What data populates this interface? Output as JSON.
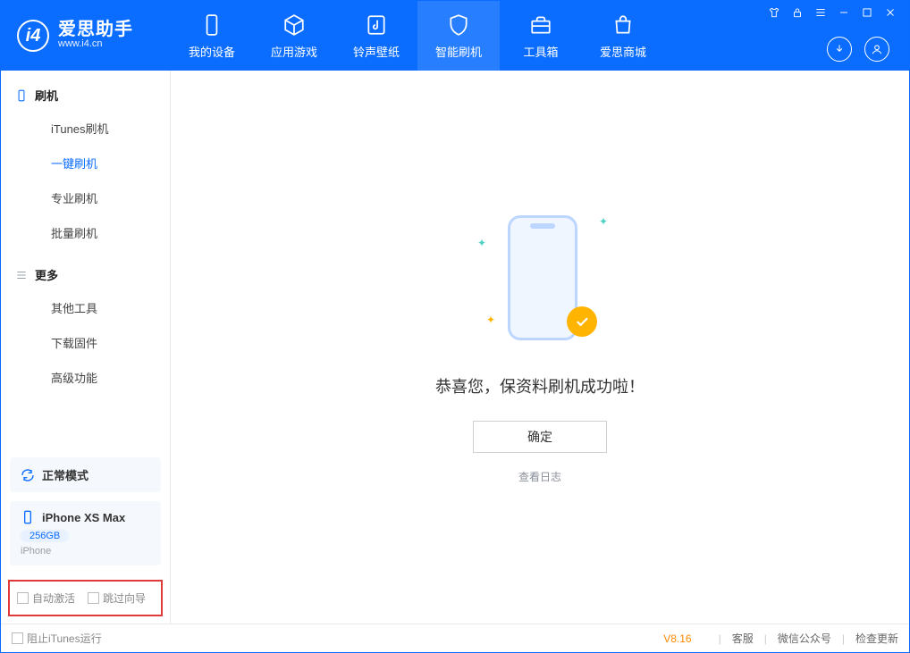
{
  "app": {
    "name": "爱思助手",
    "url": "www.i4.cn"
  },
  "nav": {
    "items": [
      {
        "label": "我的设备"
      },
      {
        "label": "应用游戏"
      },
      {
        "label": "铃声壁纸"
      },
      {
        "label": "智能刷机"
      },
      {
        "label": "工具箱"
      },
      {
        "label": "爱思商城"
      }
    ]
  },
  "sidebar": {
    "section_flash": "刷机",
    "items_flash": [
      {
        "label": "iTunes刷机"
      },
      {
        "label": "一键刷机"
      },
      {
        "label": "专业刷机"
      },
      {
        "label": "批量刷机"
      }
    ],
    "section_more": "更多",
    "items_more": [
      {
        "label": "其他工具"
      },
      {
        "label": "下载固件"
      },
      {
        "label": "高级功能"
      }
    ]
  },
  "device": {
    "mode_label": "正常模式",
    "name": "iPhone XS Max",
    "capacity": "256GB",
    "type": "iPhone"
  },
  "options": {
    "auto_activate": "自动激活",
    "skip_guide": "跳过向导"
  },
  "main": {
    "success_msg": "恭喜您，保资料刷机成功啦！",
    "ok": "确定",
    "view_log": "查看日志"
  },
  "footer": {
    "block_itunes": "阻止iTunes运行",
    "version": "V8.16",
    "support": "客服",
    "wechat": "微信公众号",
    "update": "检查更新"
  }
}
